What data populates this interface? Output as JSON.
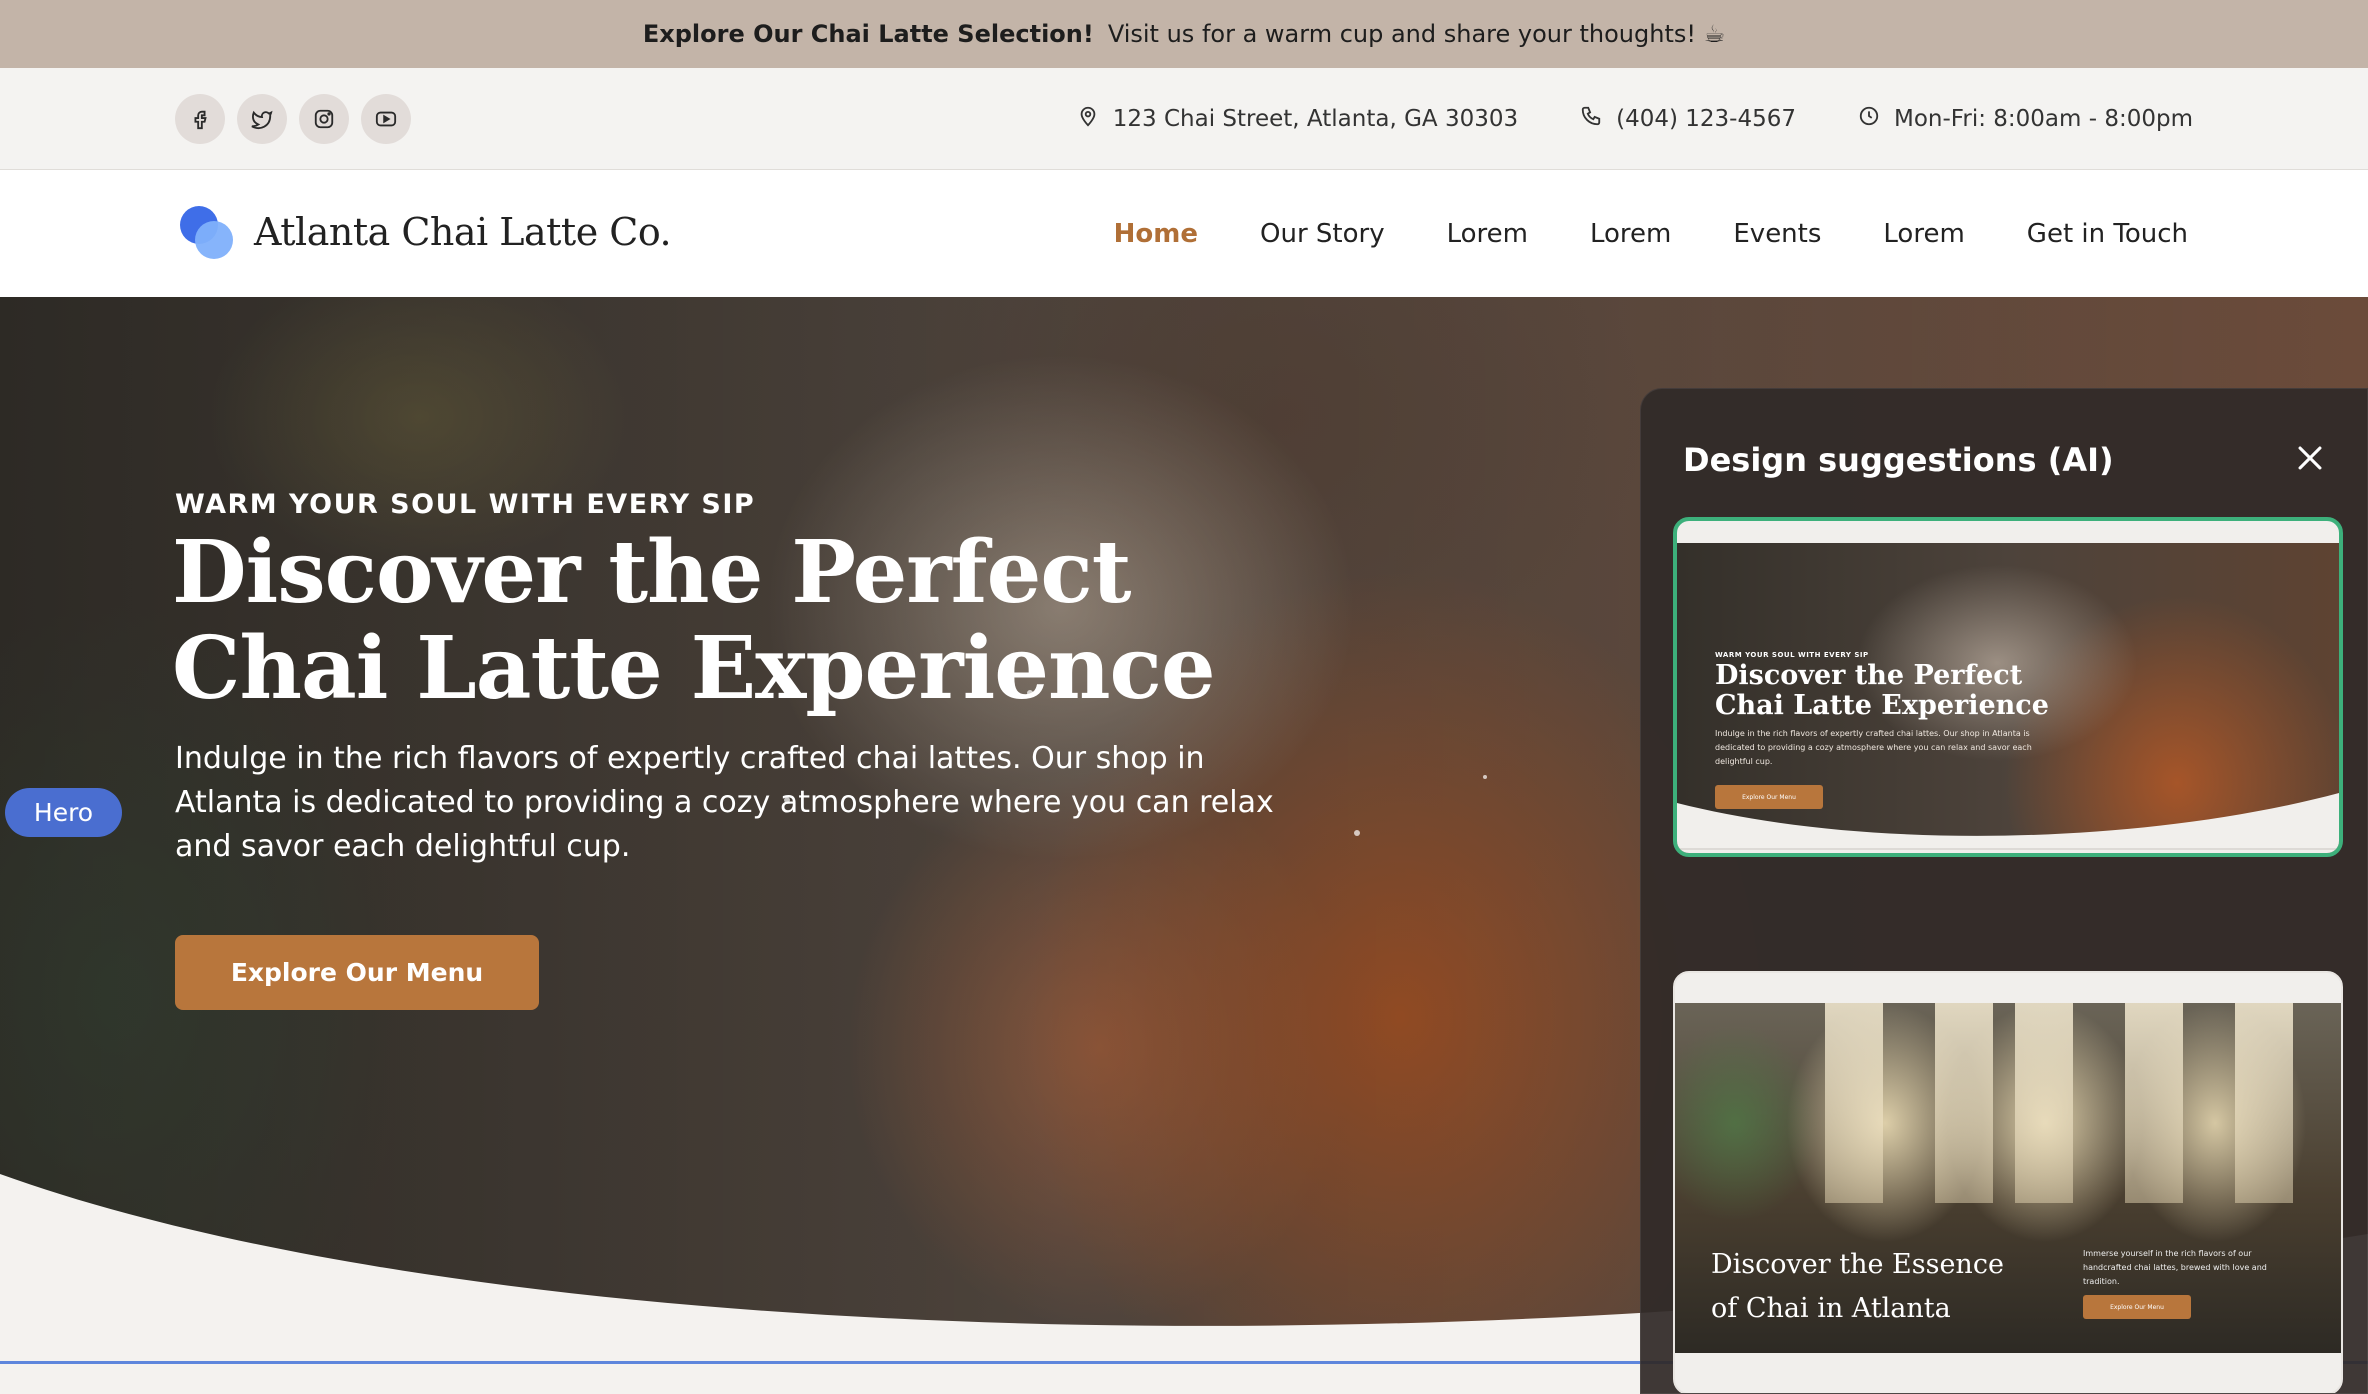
{
  "announcement": {
    "bold": "Explore Our Chai Latte Selection!",
    "text": "Visit us for a warm cup and share your thoughts! ☕"
  },
  "infobar": {
    "social": [
      "facebook-icon",
      "twitter-icon",
      "instagram-icon",
      "youtube-icon"
    ],
    "address": "123 Chai Street, Atlanta, GA 30303",
    "phone": "(404) 123-4567",
    "hours": "Mon-Fri: 8:00am - 8:00pm"
  },
  "nav": {
    "brand": "Atlanta Chai Latte Co.",
    "items": [
      "Home",
      "Our Story",
      "Lorem",
      "Lorem",
      "Events",
      "Lorem",
      "Get in Touch"
    ],
    "active": "Home"
  },
  "hero": {
    "kicker": "WARM YOUR SOUL WITH EVERY SIP",
    "title": "Discover the Perfect Chai Latte Experience",
    "description": "Indulge in the rich flavors of expertly crafted chai lattes. Our shop in Atlanta is dedicated to providing a cozy atmosphere where you can relax and savor each delightful cup.",
    "cta": "Explore Our Menu",
    "section_tag": "Hero"
  },
  "panel": {
    "title": "Design suggestions (AI)",
    "suggestions": [
      {
        "kicker": "WARM YOUR SOUL WITH EVERY SIP",
        "title": "Discover the Perfect Chai Latte Experience",
        "description": "Indulge in the rich flavors of expertly crafted chai lattes. Our shop in Atlanta is dedicated to providing a cozy atmosphere where you can relax and savor each delightful cup.",
        "cta": "Explore Our Menu",
        "selected": true
      },
      {
        "title": "Discover the Essence of Chai in Atlanta",
        "description": "Immerse yourself in the rich flavors of our handcrafted chai lattes, brewed with love and tradition.",
        "cta": "Explore Our Menu",
        "selected": false
      }
    ]
  },
  "colors": {
    "accent": "#b8763c",
    "active_nav": "#b06f36",
    "announce_bg": "#c3b4a8",
    "selected_border": "#3db07b",
    "section_tag": "#4a6ed0"
  }
}
